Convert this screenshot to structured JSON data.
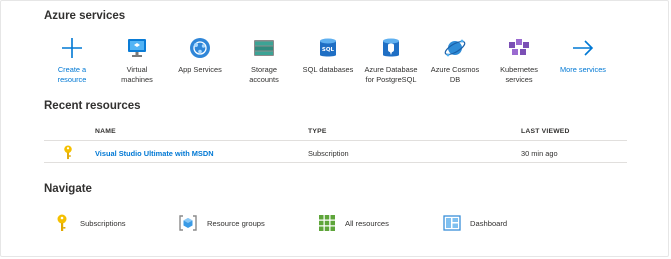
{
  "azure_services": {
    "title": "Azure services",
    "items": [
      {
        "label_lines": [
          "Create a",
          "resource"
        ],
        "icon": "plus-icon"
      },
      {
        "label_lines": [
          "Virtual",
          "machines"
        ],
        "icon": "virtual-machine-icon"
      },
      {
        "label_lines": [
          "App Services"
        ],
        "icon": "app-services-icon"
      },
      {
        "label_lines": [
          "Storage",
          "accounts"
        ],
        "icon": "storage-accounts-icon"
      },
      {
        "label_lines": [
          "SQL databases"
        ],
        "icon": "sql-database-icon"
      },
      {
        "label_lines": [
          "Azure Database",
          "for PostgreSQL"
        ],
        "icon": "postgresql-icon"
      },
      {
        "label_lines": [
          "Azure Cosmos",
          "DB"
        ],
        "icon": "cosmos-db-icon"
      },
      {
        "label_lines": [
          "Kubernetes",
          "services"
        ],
        "icon": "kubernetes-icon"
      },
      {
        "label_lines": [
          "More services"
        ],
        "icon": "arrow-right-icon"
      }
    ]
  },
  "recent_resources": {
    "title": "Recent resources",
    "columns": {
      "name": "NAME",
      "type": "TYPE",
      "last_viewed": "LAST VIEWED"
    },
    "rows": [
      {
        "name": "Visual Studio Ultimate with MSDN",
        "type": "Subscription",
        "last_viewed": "30 min ago",
        "icon": "key-icon"
      }
    ]
  },
  "navigate": {
    "title": "Navigate",
    "items": [
      {
        "label": "Subscriptions",
        "icon": "key-icon"
      },
      {
        "label": "Resource groups",
        "icon": "resource-group-icon"
      },
      {
        "label": "All resources",
        "icon": "grid-icon"
      },
      {
        "label": "Dashboard",
        "icon": "dashboard-icon"
      }
    ]
  },
  "colors": {
    "accent": "#0078d4",
    "key": "#f5c000",
    "grid": "#5ea53a"
  }
}
